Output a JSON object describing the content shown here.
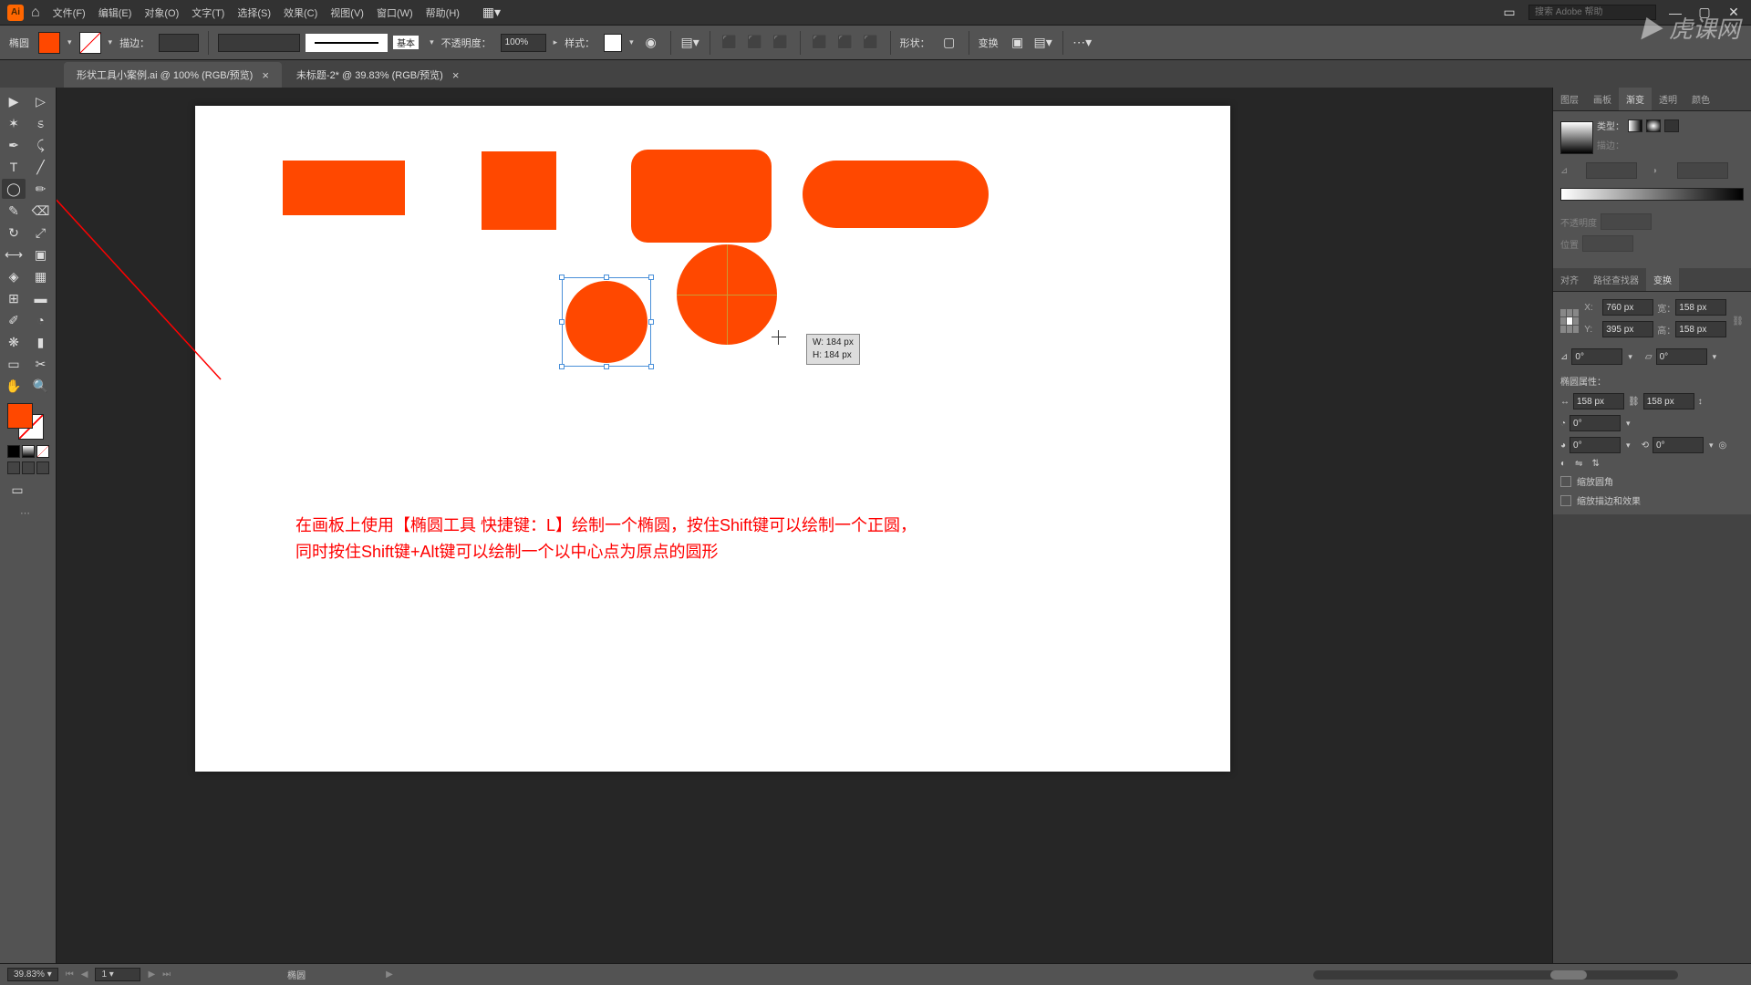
{
  "menu": {
    "items": [
      "文件(F)",
      "编辑(E)",
      "对象(O)",
      "文字(T)",
      "选择(S)",
      "效果(C)",
      "视图(V)",
      "窗口(W)",
      "帮助(H)"
    ],
    "search_placeholder": "搜索 Adobe 帮助"
  },
  "control": {
    "tool_label": "椭圆",
    "stroke_label": "描边：",
    "brush_label": "基本",
    "opacity_label": "不透明度：",
    "opacity_value": "100%",
    "style_label": "样式：",
    "shape_label": "形状：",
    "transform_label": "变换"
  },
  "tabs": [
    {
      "title": "形状工具小案例.ai @ 100% (RGB/预览)"
    },
    {
      "title": "未标题-2* @ 39.83% (RGB/预览)"
    }
  ],
  "canvas": {
    "tooltip_w": "W: 184 px",
    "tooltip_h": "H: 184 px",
    "instruction_line1": "在画板上使用【椭圆工具 快捷键：L】绘制一个椭圆，按住Shift键可以绘制一个正圆，",
    "instruction_line2": "同时按住Shift键+Alt键可以绘制一个以中心点为原点的圆形"
  },
  "panels": {
    "group1_tabs": [
      "图层",
      "画板",
      "渐变",
      "透明",
      "颜色"
    ],
    "group1_active": 2,
    "gradient": {
      "type_label": "类型：",
      "stroke_label": "描边：",
      "opacity_label": "不透明度",
      "position_label": "位置"
    },
    "group2_tabs": [
      "对齐",
      "路径查找器",
      "变换"
    ],
    "group2_active": 2,
    "transform": {
      "x_label": "X:",
      "x_value": "760 px",
      "w_label": "宽：",
      "w_value": "158 px",
      "y_label": "Y:",
      "y_value": "395 px",
      "h_label": "高：",
      "h_value": "158 px",
      "angle_value": "0°",
      "shear_value": "0°",
      "section_label": "椭圆属性：",
      "ew_value": "158 px",
      "eh_value": "158 px",
      "pie1": "0°",
      "pie2": "0°",
      "check1": "缩放圆角",
      "check2": "缩放描边和效果"
    }
  },
  "status": {
    "zoom": "39.83%",
    "page": "1",
    "tool": "椭圆"
  },
  "watermark": "虎课网"
}
